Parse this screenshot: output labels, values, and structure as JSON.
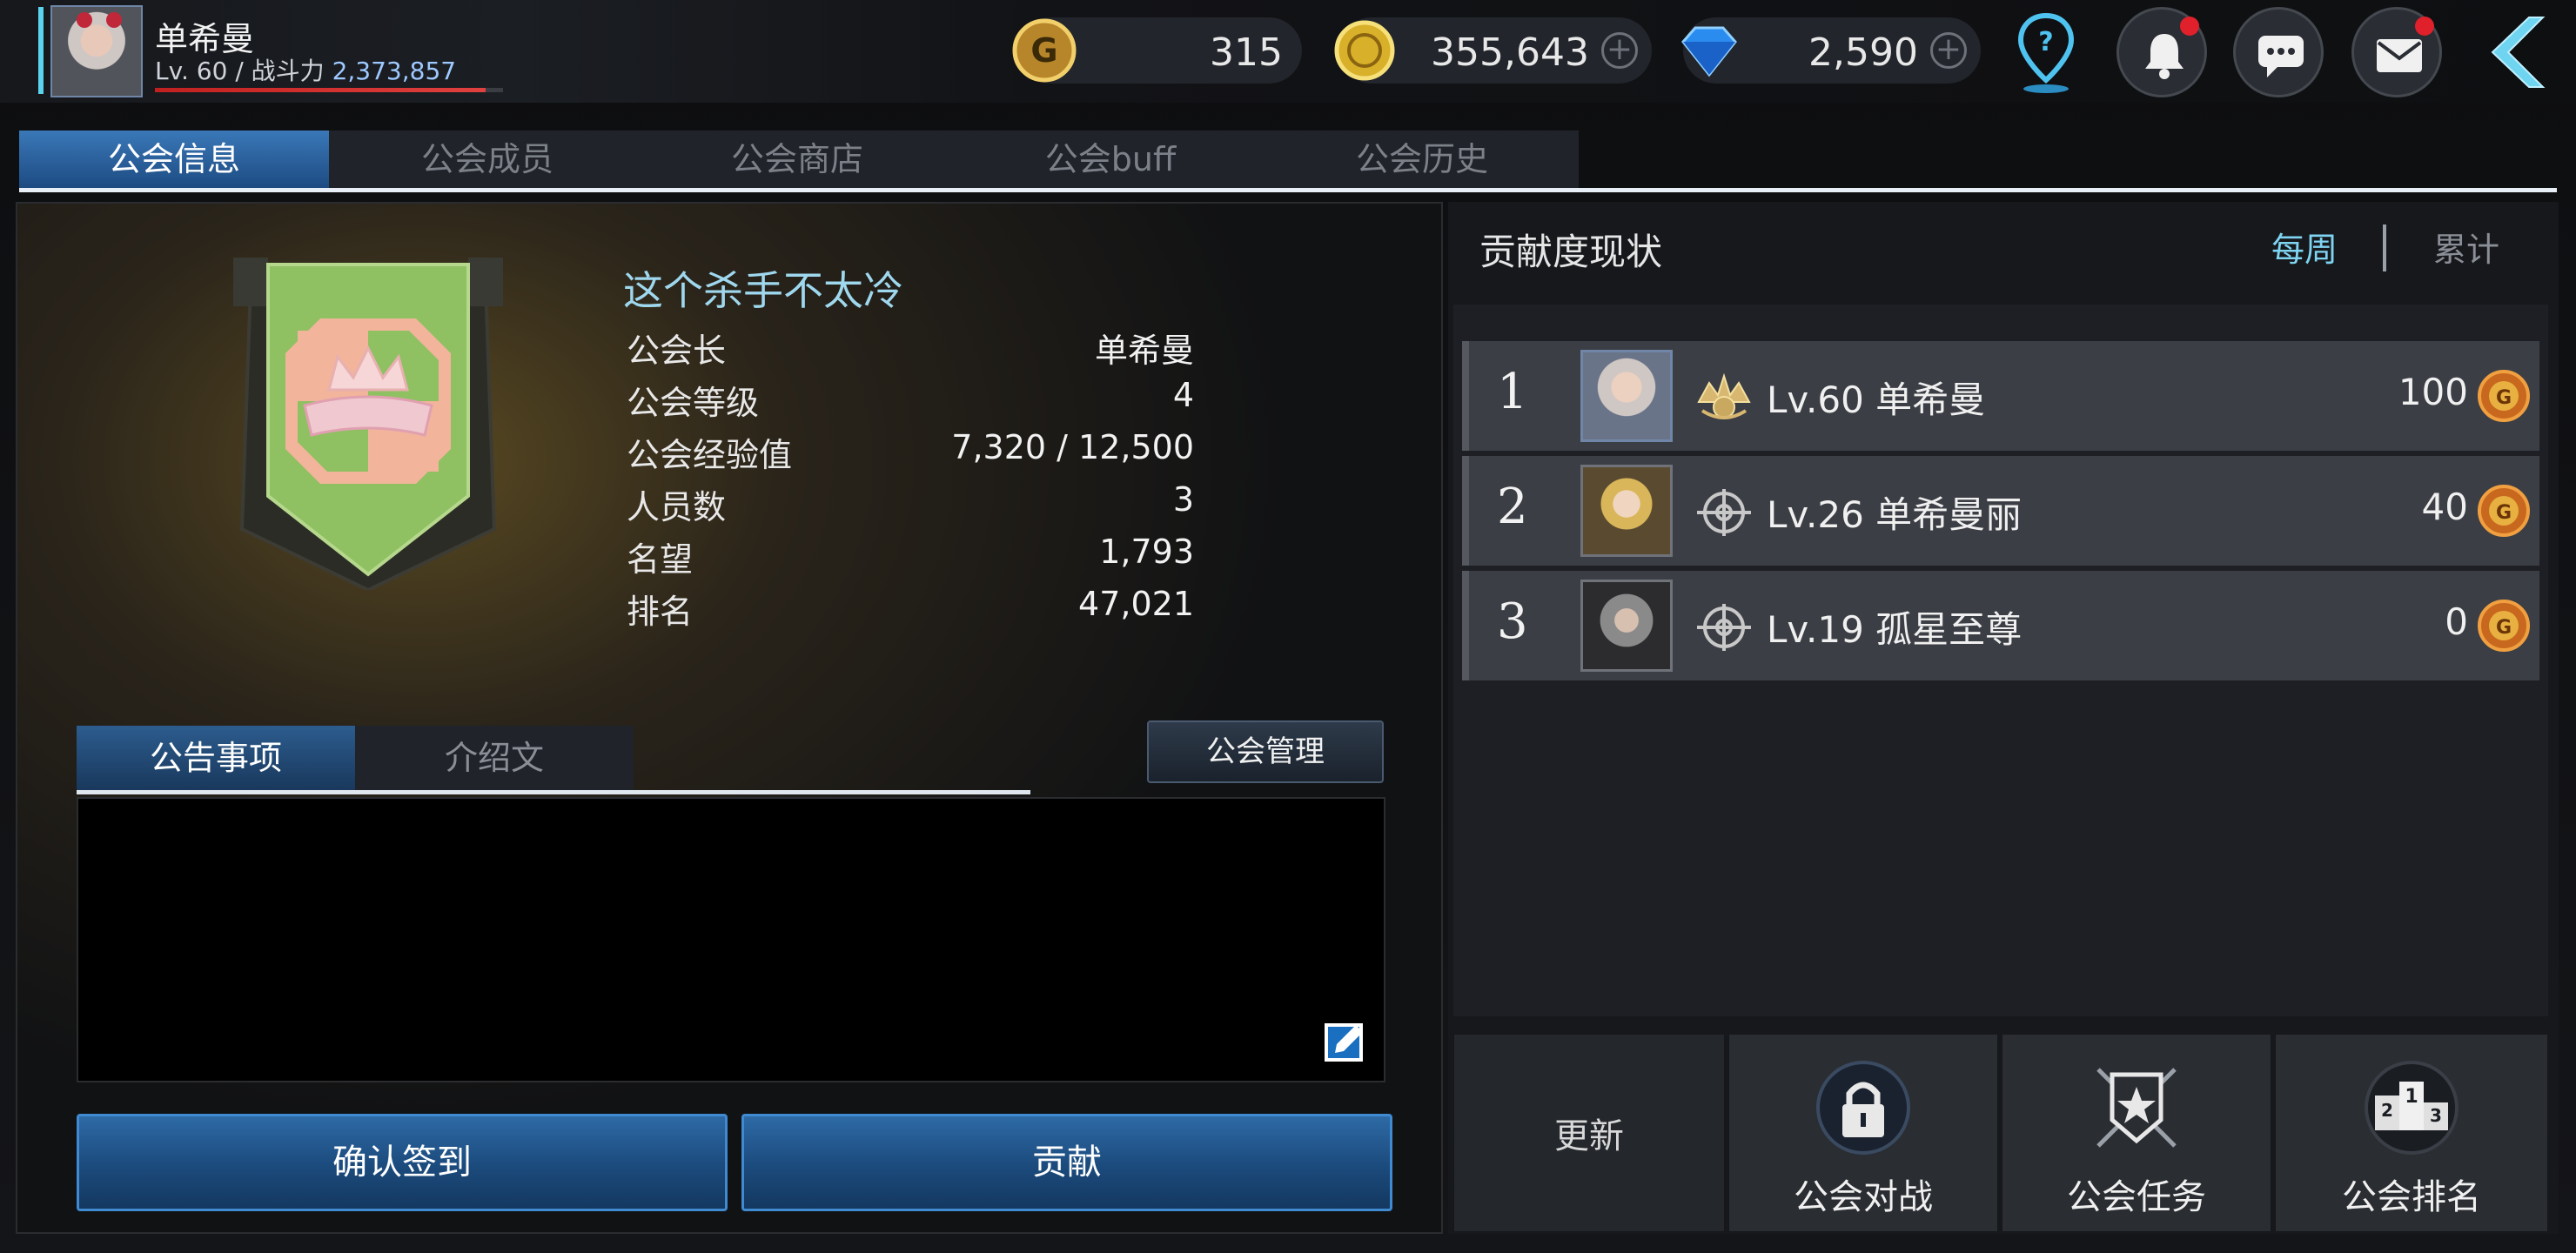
{
  "player": {
    "name": "单希曼",
    "level_prefix": "Lv. 60 / 战斗力",
    "power": "2,373,857",
    "hp_fraction": 0.95
  },
  "currencies": [
    {
      "name": "g-coin",
      "value": "315",
      "color": "#d8a531"
    },
    {
      "name": "gold",
      "value": "355,643",
      "color": "#e7c33a"
    },
    {
      "name": "diamond",
      "value": "2,590",
      "color": "#2b8cf0"
    }
  ],
  "top_icons": [
    "location-pin-icon",
    "bell-icon",
    "chat-icon",
    "mail-icon",
    "back-arrow-icon"
  ],
  "tabs": [
    {
      "label": "公会信息",
      "active": true
    },
    {
      "label": "公会成员",
      "active": false
    },
    {
      "label": "公会商店",
      "active": false
    },
    {
      "label": "公会buff",
      "active": false
    },
    {
      "label": "公会历史",
      "active": false
    }
  ],
  "guild": {
    "name": "这个杀手不太冷",
    "info": [
      {
        "label": "公会长",
        "value": "单希曼"
      },
      {
        "label": "公会等级",
        "value": "4"
      },
      {
        "label": "公会经验值",
        "value": "7,320 / 12,500"
      },
      {
        "label": "人员数",
        "value": "3"
      },
      {
        "label": "名望",
        "value": "1,793"
      },
      {
        "label": "排名",
        "value": "47,021"
      }
    ]
  },
  "subtabs": [
    {
      "label": "公告事项",
      "active": true
    },
    {
      "label": "介绍文",
      "active": false
    }
  ],
  "manage_button": "公会管理",
  "notice_text": "",
  "buttons": {
    "checkin": "确认签到",
    "contribute": "贡献"
  },
  "contribution": {
    "title": "贡献度现状",
    "period_weekly": "每周",
    "period_total": "累计",
    "rows": [
      {
        "rank": "1",
        "name": "Lv.60 单希曼",
        "points": "100",
        "badge": "leader-crown-icon"
      },
      {
        "rank": "2",
        "name": "Lv.26 单希曼丽",
        "points": "40",
        "badge": "crosshair-icon"
      },
      {
        "rank": "3",
        "name": "Lv.19 孤星至尊",
        "points": "0",
        "badge": "crosshair-icon"
      }
    ]
  },
  "bottom_buttons": {
    "refresh": "更新",
    "war": "公会对战",
    "quest": "公会任务",
    "ranking": "公会排名"
  }
}
